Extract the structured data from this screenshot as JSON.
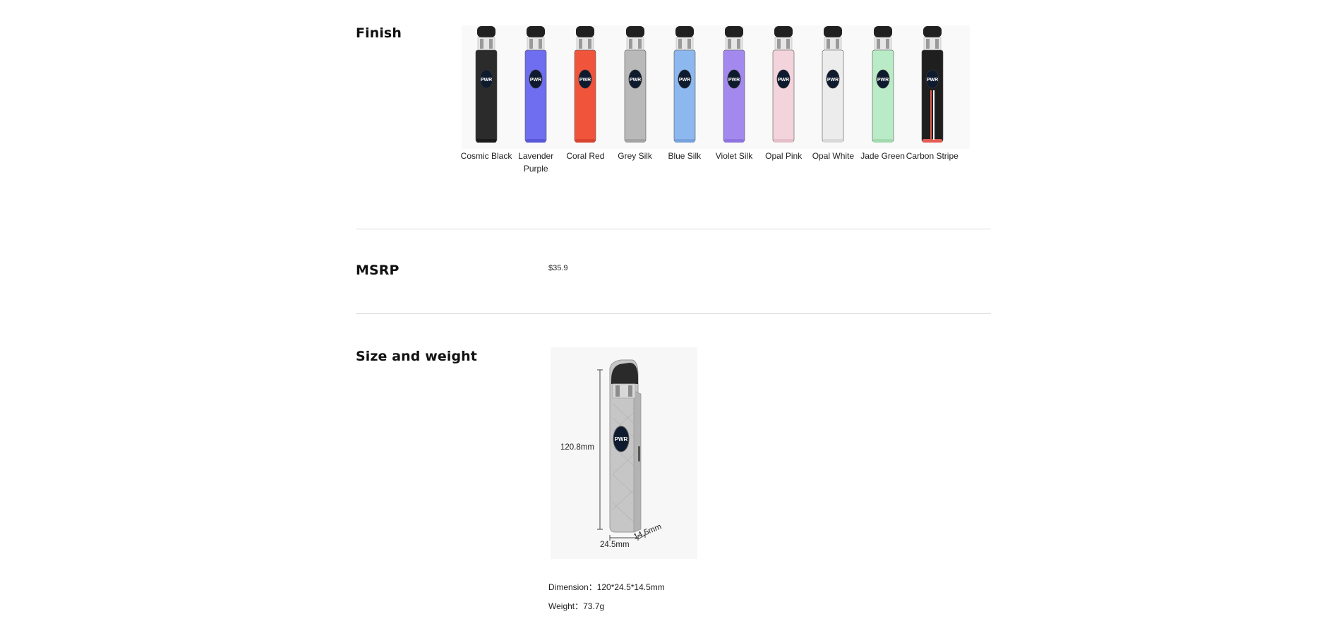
{
  "finish": {
    "title": "Finish",
    "swatches": [
      {
        "label": "Cosmic Black",
        "body": "#2b2b2b",
        "accent": "#1a1a1a"
      },
      {
        "label": "Lavender Purple",
        "body": "#6f6ef0",
        "accent": "#5958d8"
      },
      {
        "label": "Coral Red",
        "body": "#f0553c",
        "accent": "#d84430"
      },
      {
        "label": "Grey Silk",
        "body": "#b9b9b9",
        "accent": "#a3a3a3"
      },
      {
        "label": "Blue Silk",
        "body": "#8db8ef",
        "accent": "#77a3dc"
      },
      {
        "label": "Violet Silk",
        "body": "#a389ee",
        "accent": "#8f73de"
      },
      {
        "label": "Opal Pink",
        "body": "#f3d3dc",
        "accent": "#e5bfca"
      },
      {
        "label": "Opal White",
        "body": "#ececec",
        "accent": "#d9d9d9"
      },
      {
        "label": "Jade Green",
        "body": "#b9ecc6",
        "accent": "#a2dab0"
      },
      {
        "label": "Carbon Stripe",
        "body": "#1f1f1f",
        "accent": "#e35d55"
      }
    ],
    "screen_text": "PWR"
  },
  "msrp": {
    "title": "MSRP",
    "value": "$35.9"
  },
  "size_weight": {
    "title": "Size and weight",
    "height_label": "120.8mm",
    "width_label": "24.5mm",
    "depth_label": "14.5mm",
    "dimension_text": "Dimension：120*24.5*14.5mm",
    "weight_text": "Weight：73.7g",
    "device_color": "#c4c4c4",
    "screen_text": "PWR"
  }
}
